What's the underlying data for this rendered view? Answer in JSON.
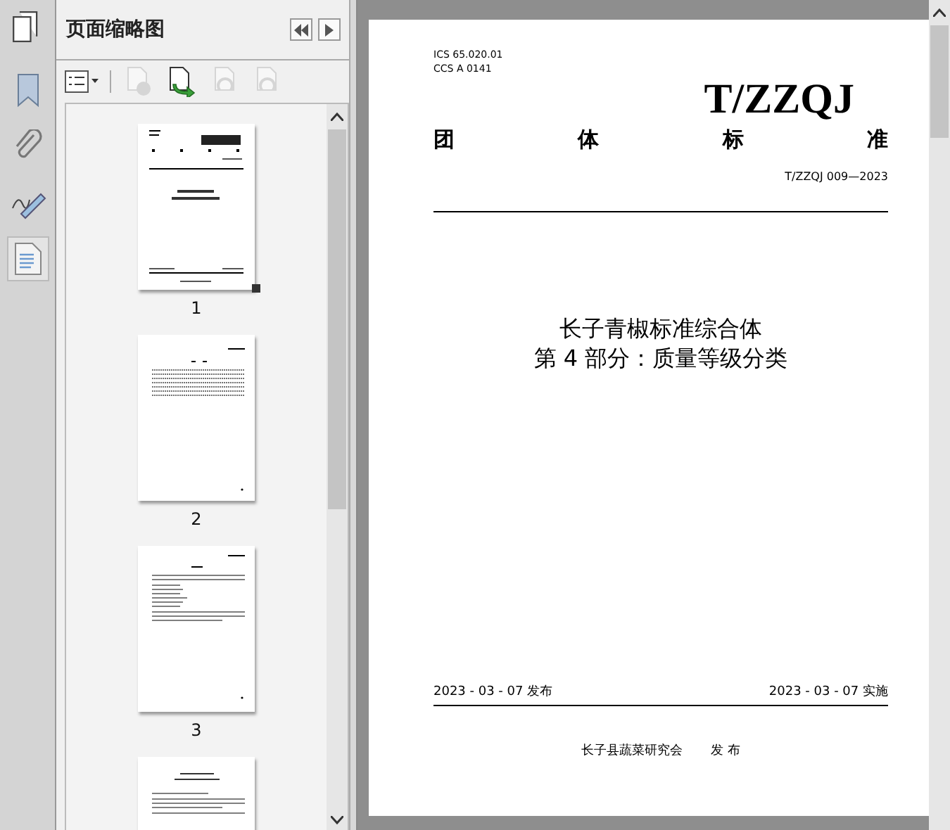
{
  "panel": {
    "title": "页面缩略图"
  },
  "toolbar": [
    {
      "kind": "options",
      "disabled": false
    },
    {
      "kind": "delete",
      "disabled": true
    },
    {
      "kind": "insert",
      "disabled": false
    },
    {
      "kind": "rotate-left",
      "disabled": true
    },
    {
      "kind": "rotate-right",
      "disabled": true
    }
  ],
  "rail": [
    {
      "kind": "bookmark",
      "selected": false
    },
    {
      "kind": "attachment",
      "selected": false
    },
    {
      "kind": "signature",
      "selected": false
    },
    {
      "kind": "pages",
      "selected": true
    }
  ],
  "thumbnails": [
    {
      "kind": "cover",
      "label": "1",
      "selected": true
    },
    {
      "kind": "toc",
      "label": "2",
      "selected": false
    },
    {
      "kind": "text",
      "label": "3",
      "selected": false
    },
    {
      "kind": "heading"
    }
  ],
  "document": {
    "ics": [
      "ICS  65.020.01",
      "CCS  A 0141"
    ],
    "logo": "T/ZZQJ",
    "type": [
      "团",
      "体",
      "标",
      "准"
    ],
    "code": "T/ZZQJ 009—2023",
    "title": [
      "长子青椒标准综合体",
      "第 4 部分：质量等级分类"
    ],
    "issued": "2023 - 03 - 07 发布",
    "effective": "2023 - 03 - 07 实施",
    "publisher": "长子县蔬菜研究会",
    "publish_word": "发  布"
  }
}
